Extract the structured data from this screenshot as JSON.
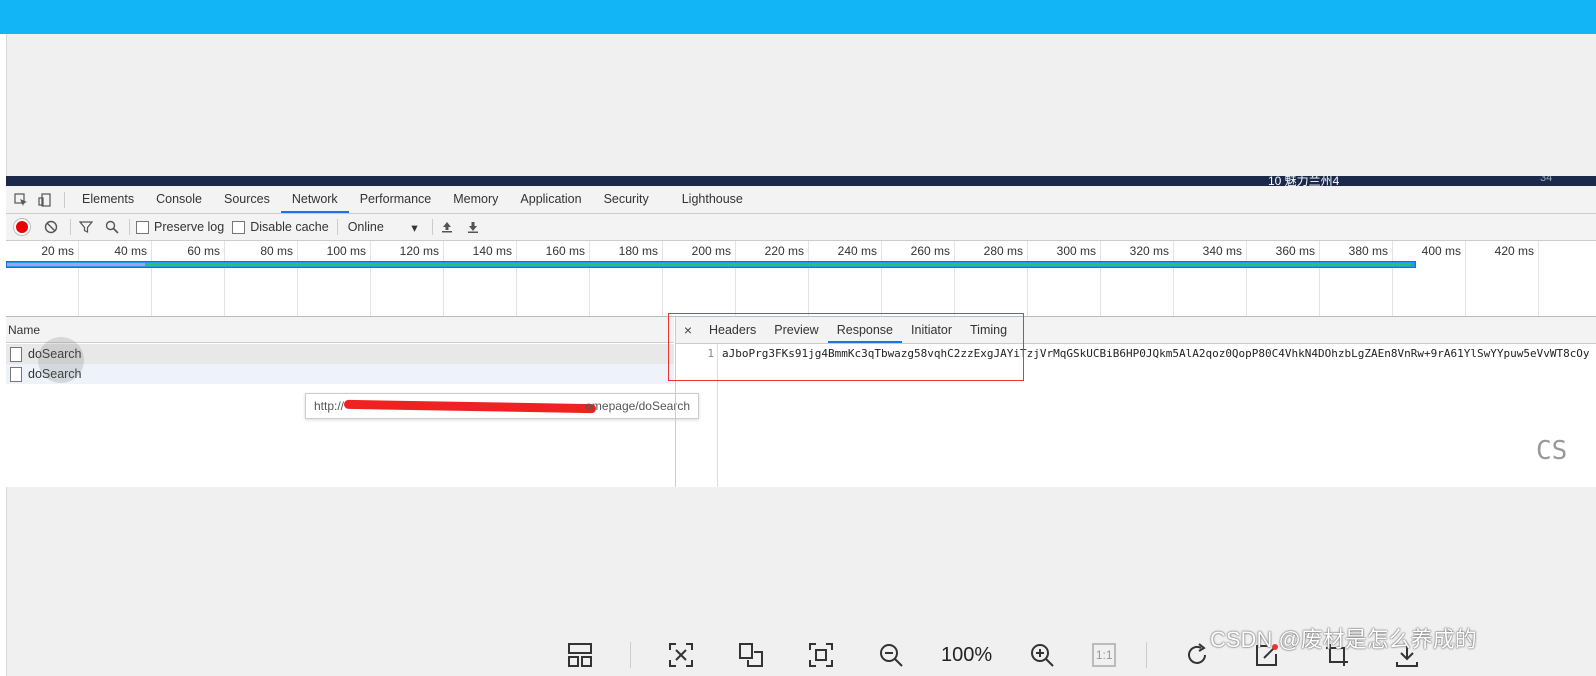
{
  "page": {
    "strip_text": "10 魅力兰州4",
    "strip_num": "34"
  },
  "devtools": {
    "tabs": [
      "Elements",
      "Console",
      "Sources",
      "Network",
      "Performance",
      "Memory",
      "Application",
      "Security",
      "Lighthouse"
    ],
    "active_tab": "Network",
    "toolbar": {
      "preserve_log": "Preserve log",
      "disable_cache": "Disable cache",
      "throttle": "Online"
    },
    "timeline_ticks": [
      "20 ms",
      "40 ms",
      "60 ms",
      "80 ms",
      "100 ms",
      "120 ms",
      "140 ms",
      "160 ms",
      "180 ms",
      "200 ms",
      "220 ms",
      "240 ms",
      "260 ms",
      "280 ms",
      "300 ms",
      "320 ms",
      "340 ms",
      "360 ms",
      "380 ms",
      "400 ms",
      "420 ms"
    ],
    "name_header": "Name",
    "requests": [
      "doSearch",
      "doSearch"
    ],
    "tooltip": {
      "prefix": "http://",
      "suffix": "omepage/doSearch"
    },
    "response_tabs": [
      "Headers",
      "Preview",
      "Response",
      "Initiator",
      "Timing"
    ],
    "active_response_tab": "Response",
    "response_line_number": "1",
    "response_body": "aJboPrg3FKs91jg4BmmKc3qTbwazg58vqhC2zzExgJAYiTzjVrMqGSkUCBiB6HP0JQkm5AlA2qoz0QopP80C4VhkN4DOhzbLgZAEn8VnRw+9rA61YlSwYYpuw5eVvWT8cOy",
    "side_text": "CS"
  },
  "viewer": {
    "zoom": "100%",
    "actual_size": "1:1"
  },
  "watermark": "CSDN @废材是怎么养成的"
}
